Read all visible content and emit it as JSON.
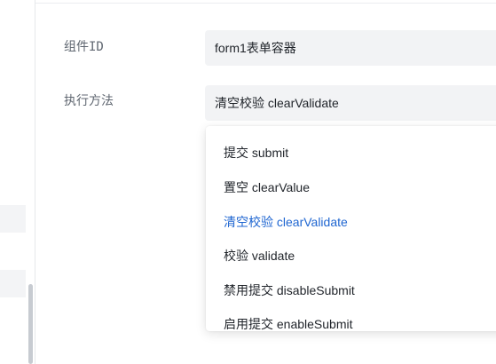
{
  "form": {
    "component_id_label": "组件ID",
    "component_id_value": "form1表单容器",
    "method_label": "执行方法",
    "method_value": "清空校验 clearValidate"
  },
  "dropdown": {
    "selected": "清空校验 clearValidate",
    "options": [
      "提交 submit",
      "置空 clearValue",
      "清空校验 clearValidate",
      "校验 validate",
      "禁用提交 disableSubmit",
      "启用提交 enableSubmit"
    ]
  },
  "colors": {
    "selected_option": "#1f66d1",
    "field_background": "#f2f3f5",
    "label_text": "#5f6670"
  }
}
